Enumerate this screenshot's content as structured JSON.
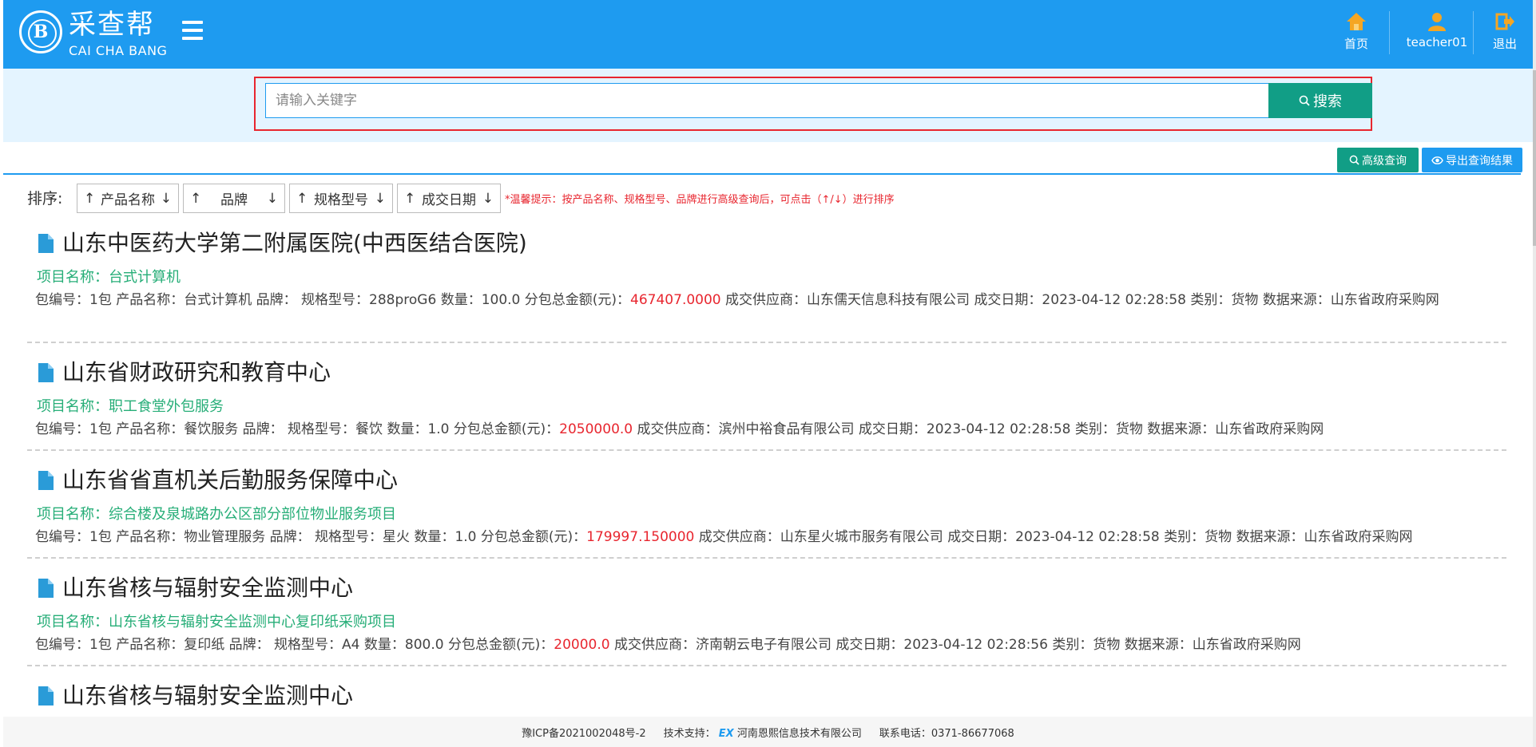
{
  "header": {
    "brand_cn": "采查帮",
    "brand_en": "CAI CHA BANG",
    "logo_letter": "B",
    "nav": [
      {
        "label": "首页",
        "icon": "home-icon"
      },
      {
        "label": "teacher01",
        "icon": "user-icon"
      },
      {
        "label": "退出",
        "icon": "logout-icon"
      }
    ],
    "accent_color": "#1e9bf0"
  },
  "search": {
    "placeholder": "请输入关键字",
    "value": "",
    "button_label": "搜索"
  },
  "toolbar": {
    "advanced_label": "高级查询",
    "export_label": "导出查询结果"
  },
  "sort": {
    "label": "排序:",
    "options": [
      "产品名称",
      "品牌",
      "规格型号",
      "成交日期"
    ],
    "tip": "*温馨提示：按产品名称、规格型号、品牌进行高级查询后，可点击（↑/↓）进行排序"
  },
  "results": [
    {
      "title": "山东中医药大学第二附属医院(中西医结合医院)",
      "project": "项目名称：台式计算机",
      "pkg": "包编号：1包",
      "product": "产品名称：台式计算机",
      "brand": "品牌：",
      "model": "规格型号：288proG6",
      "qty": "数量：100.0",
      "amount_label": "分包总金额(元)：",
      "amount": "467407.0000",
      "supplier": "成交供应商：山东儒天信息科技有限公司",
      "date": "成交日期：2023-04-12 02:28:58",
      "category": "类别：货物",
      "source": "数据来源：山东省政府采购网"
    },
    {
      "title": "山东省财政研究和教育中心",
      "project": "项目名称：职工食堂外包服务",
      "pkg": "包编号：1包",
      "product": "产品名称：餐饮服务",
      "brand": "品牌：",
      "model": "规格型号：餐饮",
      "qty": "数量：1.0",
      "amount_label": "分包总金额(元)：",
      "amount": "2050000.0",
      "supplier": "成交供应商：滨州中裕食品有限公司",
      "date": "成交日期：2023-04-12 02:28:58",
      "category": "类别：货物",
      "source": "数据来源：山东省政府采购网"
    },
    {
      "title": "山东省省直机关后勤服务保障中心",
      "project": "项目名称：综合楼及泉城路办公区部分部位物业服务项目",
      "pkg": "包编号：1包",
      "product": "产品名称：物业管理服务",
      "brand": "品牌：",
      "model": "规格型号：星火",
      "qty": "数量：1.0",
      "amount_label": "分包总金额(元)：",
      "amount": "179997.150000",
      "supplier": "成交供应商：山东星火城市服务有限公司",
      "date": "成交日期：2023-04-12 02:28:58",
      "category": "类别：货物",
      "source": "数据来源：山东省政府采购网"
    },
    {
      "title": "山东省核与辐射安全监测中心",
      "project": "项目名称：山东省核与辐射安全监测中心复印纸采购项目",
      "pkg": "包编号：1包",
      "product": "产品名称：复印纸",
      "brand": "品牌：",
      "model": "规格型号：A4",
      "qty": "数量：800.0",
      "amount_label": "分包总金额(元)：",
      "amount": "20000.0",
      "supplier": "成交供应商：济南朝云电子有限公司",
      "date": "成交日期：2023-04-12 02:28:56",
      "category": "类别：货物",
      "source": "数据来源：山东省政府采购网"
    },
    {
      "title": "山东省核与辐射安全监测中心"
    }
  ],
  "footer": {
    "icp": "豫ICP备2021002048号-2",
    "support_label": "技术支持：",
    "ex_logo": "EX",
    "company": "河南恩熙信息技术有限公司",
    "phone": "联系电话：0371-86677068"
  }
}
